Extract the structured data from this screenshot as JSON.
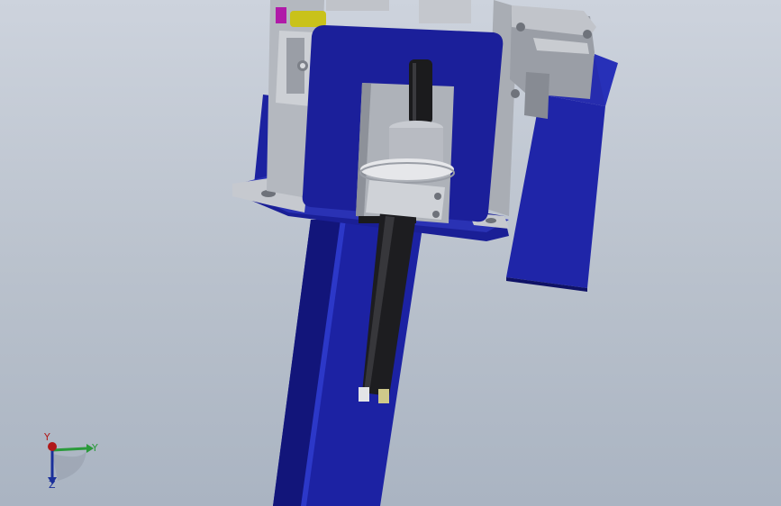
{
  "viewport": {
    "background_top": "#cdd3dd",
    "background_bottom": "#aab4c2"
  },
  "model": {
    "colors": {
      "body_blue": "#1a1d8f",
      "body_blue_light": "#2a34b8",
      "body_blue_dark": "#0d0f5a",
      "steel": "#b9bdc4",
      "steel_dark": "#8a8f97",
      "shaft_black": "#1b1b1d",
      "flange_white": "#e6e7ea",
      "accent_yellow": "#c9c21a",
      "accent_magenta": "#b01aa8"
    }
  },
  "triad": {
    "x_label": "Y",
    "y_label": "Y",
    "z_label": "Z",
    "colors": {
      "x": "#b01818",
      "y": "#2a9a3a",
      "z": "#1a2f9a"
    }
  }
}
